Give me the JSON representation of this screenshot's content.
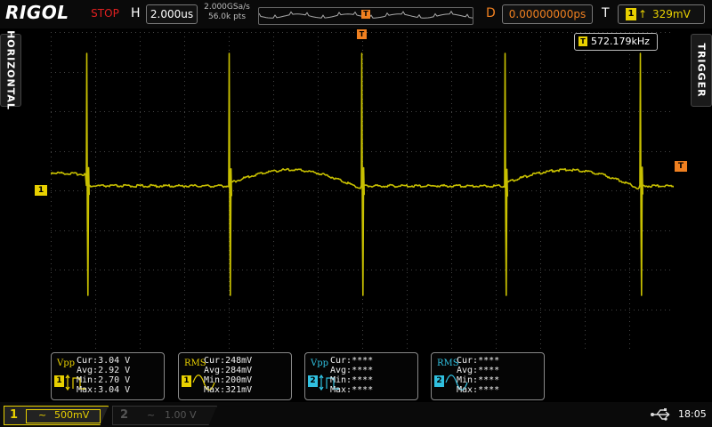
{
  "header": {
    "brand": "RIGOL",
    "run_state": "STOP",
    "horizontal_label": "H",
    "timebase": "2.000us",
    "sample_rate": "2.000GSa/s",
    "memory_depth": "56.0k pts",
    "trigger_position_marker": "T",
    "delay_label": "D",
    "delay_value": "0.00000000ps",
    "trigger_label": "T",
    "trigger_source": "1",
    "trigger_edge": "rising-edge",
    "trigger_level": "329mV"
  },
  "side_tabs": {
    "left": "HORIZONTAL",
    "right": "TRIGGER"
  },
  "display": {
    "frequency_icon": "T",
    "frequency": "572.179kHz",
    "ch1_marker": "1",
    "trigger_level_marker": "T",
    "trace_color": "#c8c000"
  },
  "measurements": [
    {
      "name": "Vpp",
      "channel": "1",
      "cur": "Cur:3.04 V",
      "avg": "Avg:2.92 V",
      "min": "Min:2.70 V",
      "max": "Max:3.04 V"
    },
    {
      "name": "RMS",
      "channel": "1",
      "cur": "Cur:248mV",
      "avg": "Avg:284mV",
      "min": "Min:200mV",
      "max": "Max:321mV"
    },
    {
      "name": "Vpp",
      "channel": "2",
      "cur": "Cur:****",
      "avg": "Avg:****",
      "min": "Min:****",
      "max": "Max:****"
    },
    {
      "name": "RMS",
      "channel": "2",
      "cur": "Cur:****",
      "avg": "Avg:****",
      "min": "Min:****",
      "max": "Max:****"
    }
  ],
  "footer": {
    "ch1": {
      "num": "1",
      "coupling": "~",
      "scale": "500mV"
    },
    "ch2": {
      "num": "2",
      "coupling": "~",
      "scale": "1.00 V"
    },
    "usb_icon": "usb-icon",
    "time": "18:05"
  },
  "colors": {
    "ch1": "#e8d000",
    "ch2": "#30c0e0",
    "trigger": "#f08020",
    "stop": "#e02020"
  }
}
